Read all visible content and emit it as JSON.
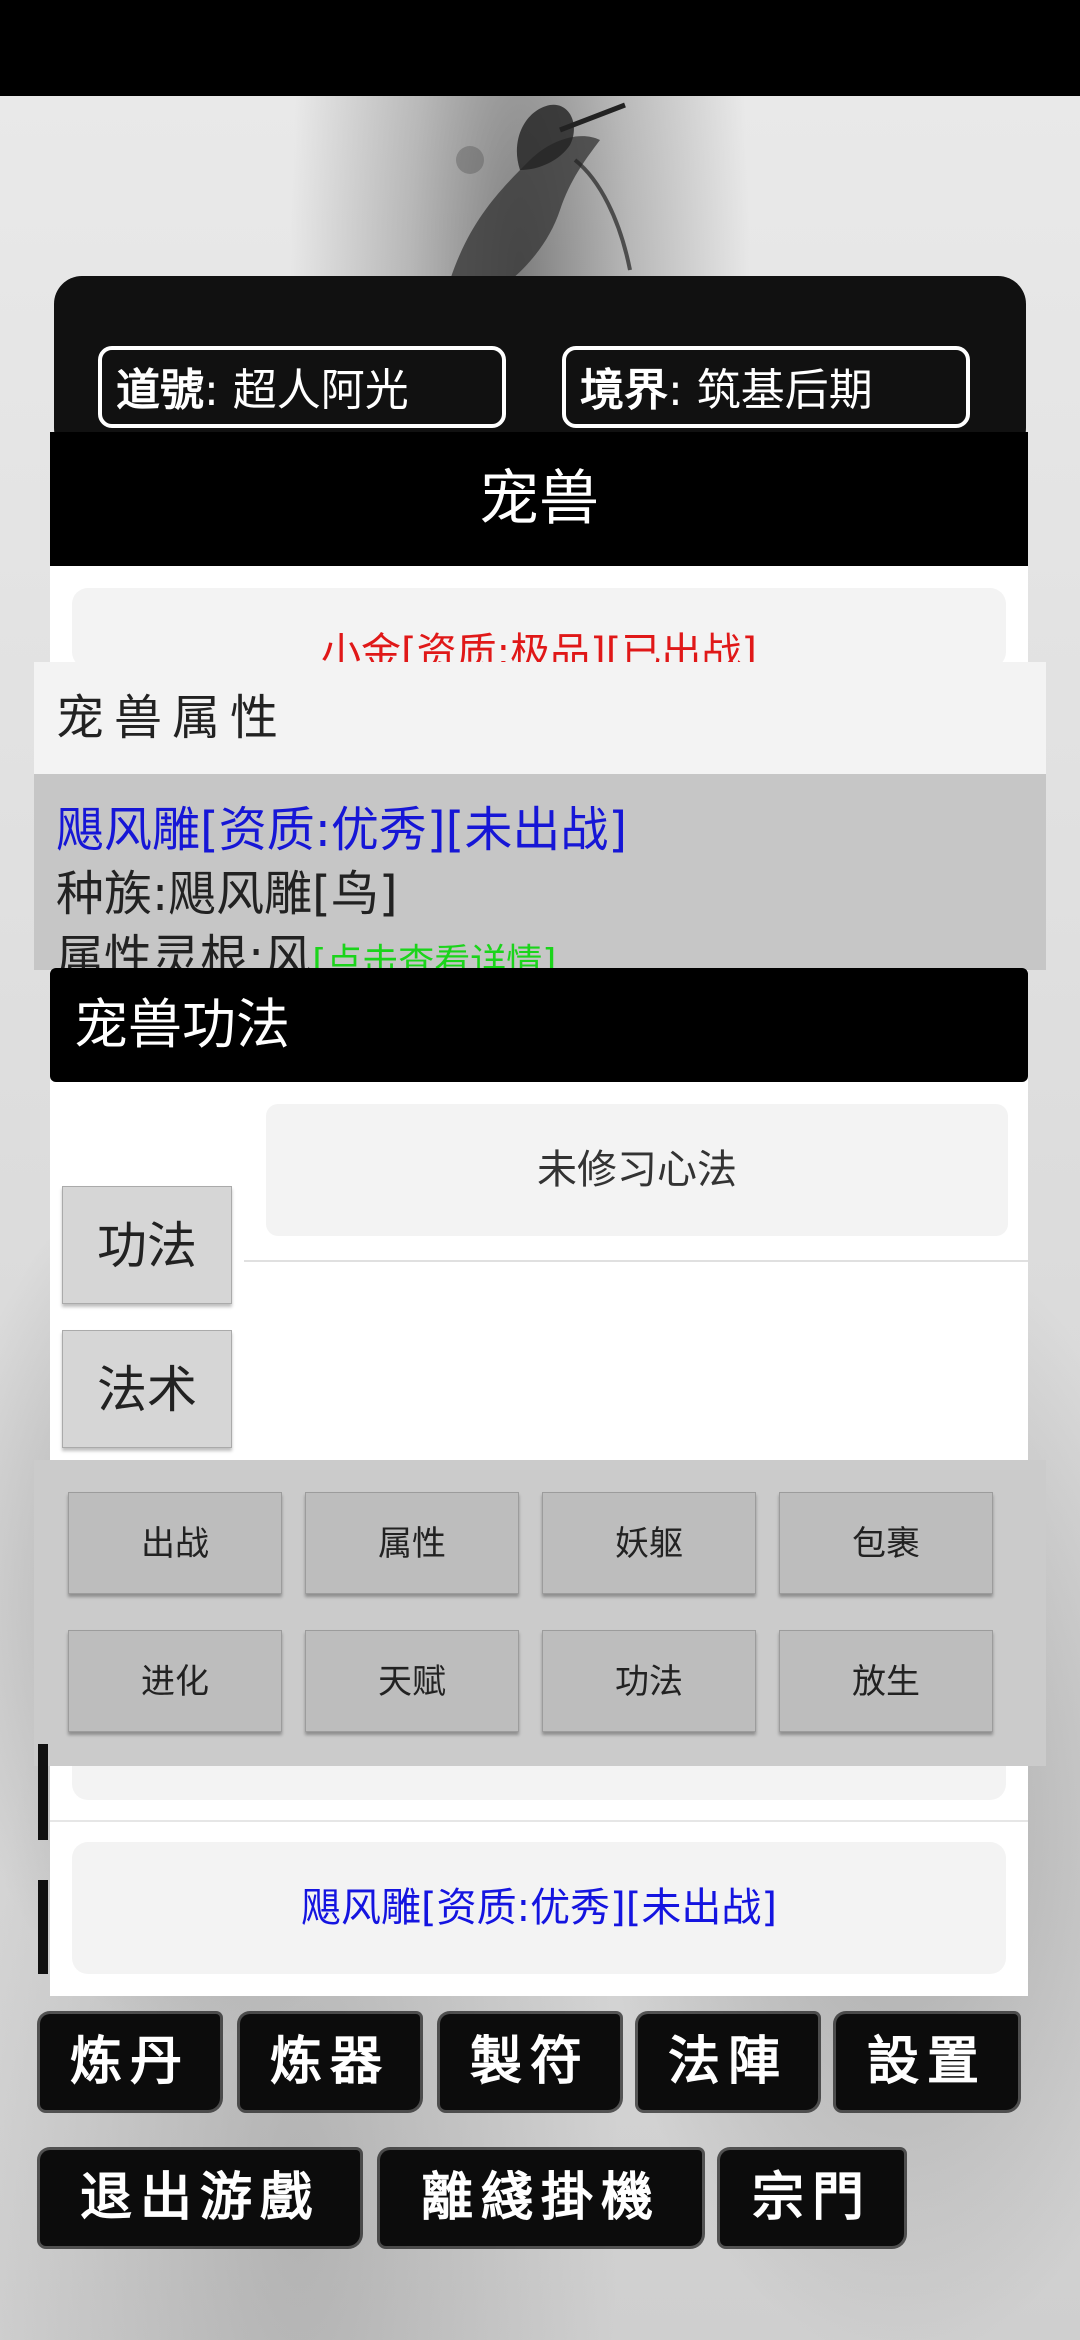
{
  "status": {
    "daohao_label": "道號",
    "daohao_value": ": 超人阿光",
    "jingjie_label": "境界",
    "jingjie_value": ": 筑基后期"
  },
  "pet_panel": {
    "title": "宠兽",
    "list": [
      "小金[资质:极品][已出战]",
      "飓风雕[资质:优秀][未出战]"
    ]
  },
  "attributes": {
    "title": "宠兽属性",
    "name_line": "飓风雕[资质:优秀][未出战]",
    "race_line": "种族:飓风雕[鸟]",
    "root_label": "属性灵根:风",
    "root_link": "[点击查看详情]"
  },
  "skills": {
    "title": "宠兽功法",
    "tabs": [
      "功法",
      "法术"
    ],
    "empty_text": "未修习心法"
  },
  "actions": [
    "出战",
    "属性",
    "妖躯",
    "包裹",
    "进化",
    "天赋",
    "功法",
    "放生"
  ],
  "bottom_menu": {
    "row1": [
      "炼丹",
      "炼器",
      "製符",
      "法陣",
      "設置"
    ],
    "row2": [
      "退出游戲",
      "離綫掛機",
      "宗門"
    ]
  }
}
